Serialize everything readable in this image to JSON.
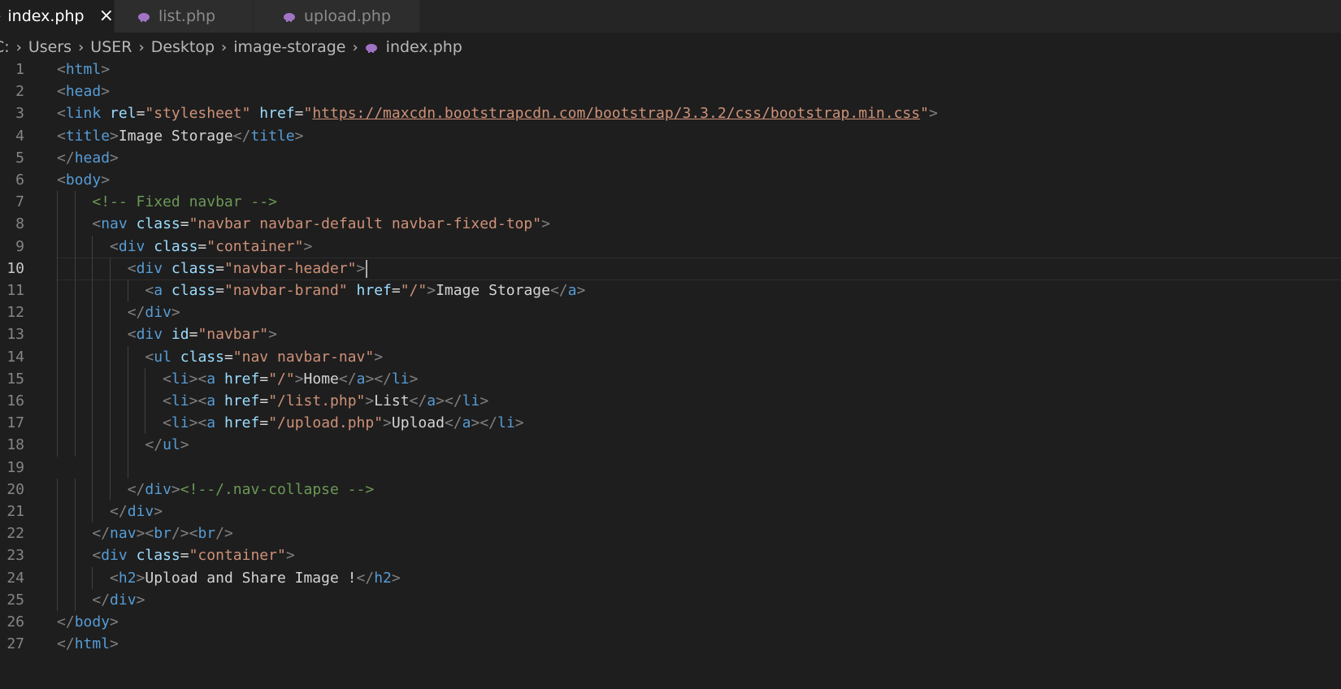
{
  "tabs": [
    {
      "label": "index.php",
      "active": true,
      "icon": "php-elephant-icon"
    },
    {
      "label": "list.php",
      "active": false,
      "icon": "php-elephant-icon"
    },
    {
      "label": "upload.php",
      "active": false,
      "icon": "php-elephant-icon"
    }
  ],
  "breadcrumb": [
    "C:",
    "Users",
    "USER",
    "Desktop",
    "image-storage",
    "index.php"
  ],
  "editor": {
    "current_line": 10,
    "lines": [
      {
        "n": "1",
        "indent": 0,
        "tokens": [
          [
            "p",
            "<"
          ],
          [
            "t",
            "html"
          ],
          [
            "p",
            ">"
          ]
        ]
      },
      {
        "n": "2",
        "indent": 0,
        "tokens": [
          [
            "p",
            "<"
          ],
          [
            "t",
            "head"
          ],
          [
            "p",
            ">"
          ]
        ]
      },
      {
        "n": "3",
        "indent": 0,
        "tokens": [
          [
            "p",
            "<"
          ],
          [
            "t",
            "link"
          ],
          [
            "x",
            " "
          ],
          [
            "a",
            "rel"
          ],
          [
            "x",
            "="
          ],
          [
            "s",
            "\"stylesheet\""
          ],
          [
            "x",
            " "
          ],
          [
            "a",
            "href"
          ],
          [
            "x",
            "="
          ],
          [
            "s",
            "\""
          ],
          [
            "u",
            "https://maxcdn.bootstrapcdn.com/bootstrap/3.3.2/css/bootstrap.min.css"
          ],
          [
            "s",
            "\""
          ],
          [
            "p",
            ">"
          ]
        ]
      },
      {
        "n": "4",
        "indent": 0,
        "tokens": [
          [
            "p",
            "<"
          ],
          [
            "t",
            "title"
          ],
          [
            "p",
            ">"
          ],
          [
            "x",
            "Image Storage"
          ],
          [
            "p",
            "</"
          ],
          [
            "t",
            "title"
          ],
          [
            "p",
            ">"
          ]
        ]
      },
      {
        "n": "5",
        "indent": 0,
        "tokens": [
          [
            "p",
            "</"
          ],
          [
            "t",
            "head"
          ],
          [
            "p",
            ">"
          ]
        ]
      },
      {
        "n": "6",
        "indent": 0,
        "tokens": [
          [
            "p",
            "<"
          ],
          [
            "t",
            "body"
          ],
          [
            "p",
            ">"
          ]
        ]
      },
      {
        "n": "7",
        "indent": 4,
        "tokens": [
          [
            "c",
            "<!-- Fixed navbar -->"
          ]
        ]
      },
      {
        "n": "8",
        "indent": 4,
        "tokens": [
          [
            "p",
            "<"
          ],
          [
            "t",
            "nav"
          ],
          [
            "x",
            " "
          ],
          [
            "a",
            "class"
          ],
          [
            "x",
            "="
          ],
          [
            "s",
            "\"navbar navbar-default navbar-fixed-top\""
          ],
          [
            "p",
            ">"
          ]
        ]
      },
      {
        "n": "9",
        "indent": 6,
        "tokens": [
          [
            "p",
            "<"
          ],
          [
            "t",
            "div"
          ],
          [
            "x",
            " "
          ],
          [
            "a",
            "class"
          ],
          [
            "x",
            "="
          ],
          [
            "s",
            "\"container\""
          ],
          [
            "p",
            ">"
          ]
        ]
      },
      {
        "n": "10",
        "indent": 8,
        "tokens": [
          [
            "p",
            "<"
          ],
          [
            "t",
            "div"
          ],
          [
            "x",
            " "
          ],
          [
            "a",
            "class"
          ],
          [
            "x",
            "="
          ],
          [
            "s",
            "\"navbar-header\""
          ],
          [
            "p",
            ">"
          ]
        ]
      },
      {
        "n": "11",
        "indent": 10,
        "tokens": [
          [
            "p",
            "<"
          ],
          [
            "t",
            "a"
          ],
          [
            "x",
            " "
          ],
          [
            "a",
            "class"
          ],
          [
            "x",
            "="
          ],
          [
            "s",
            "\"navbar-brand\""
          ],
          [
            "x",
            " "
          ],
          [
            "a",
            "href"
          ],
          [
            "x",
            "="
          ],
          [
            "s",
            "\"/\""
          ],
          [
            "p",
            ">"
          ],
          [
            "x",
            "Image Storage"
          ],
          [
            "p",
            "</"
          ],
          [
            "t",
            "a"
          ],
          [
            "p",
            ">"
          ]
        ]
      },
      {
        "n": "12",
        "indent": 8,
        "tokens": [
          [
            "p",
            "</"
          ],
          [
            "t",
            "div"
          ],
          [
            "p",
            ">"
          ]
        ]
      },
      {
        "n": "13",
        "indent": 8,
        "tokens": [
          [
            "p",
            "<"
          ],
          [
            "t",
            "div"
          ],
          [
            "x",
            " "
          ],
          [
            "a",
            "id"
          ],
          [
            "x",
            "="
          ],
          [
            "s",
            "\"navbar\""
          ],
          [
            "p",
            ">"
          ]
        ]
      },
      {
        "n": "14",
        "indent": 10,
        "tokens": [
          [
            "p",
            "<"
          ],
          [
            "t",
            "ul"
          ],
          [
            "x",
            " "
          ],
          [
            "a",
            "class"
          ],
          [
            "x",
            "="
          ],
          [
            "s",
            "\"nav navbar-nav\""
          ],
          [
            "p",
            ">"
          ]
        ]
      },
      {
        "n": "15",
        "indent": 12,
        "tokens": [
          [
            "p",
            "<"
          ],
          [
            "t",
            "li"
          ],
          [
            "p",
            "><"
          ],
          [
            "t",
            "a"
          ],
          [
            "x",
            " "
          ],
          [
            "a",
            "href"
          ],
          [
            "x",
            "="
          ],
          [
            "s",
            "\"/\""
          ],
          [
            "p",
            ">"
          ],
          [
            "x",
            "Home"
          ],
          [
            "p",
            "</"
          ],
          [
            "t",
            "a"
          ],
          [
            "p",
            "></"
          ],
          [
            "t",
            "li"
          ],
          [
            "p",
            ">"
          ]
        ]
      },
      {
        "n": "16",
        "indent": 12,
        "tokens": [
          [
            "p",
            "<"
          ],
          [
            "t",
            "li"
          ],
          [
            "p",
            "><"
          ],
          [
            "t",
            "a"
          ],
          [
            "x",
            " "
          ],
          [
            "a",
            "href"
          ],
          [
            "x",
            "="
          ],
          [
            "s",
            "\"/list.php\""
          ],
          [
            "p",
            ">"
          ],
          [
            "x",
            "List"
          ],
          [
            "p",
            "</"
          ],
          [
            "t",
            "a"
          ],
          [
            "p",
            "></"
          ],
          [
            "t",
            "li"
          ],
          [
            "p",
            ">"
          ]
        ]
      },
      {
        "n": "17",
        "indent": 12,
        "tokens": [
          [
            "p",
            "<"
          ],
          [
            "t",
            "li"
          ],
          [
            "p",
            "><"
          ],
          [
            "t",
            "a"
          ],
          [
            "x",
            " "
          ],
          [
            "a",
            "href"
          ],
          [
            "x",
            "="
          ],
          [
            "s",
            "\"/upload.php\""
          ],
          [
            "p",
            ">"
          ],
          [
            "x",
            "Upload"
          ],
          [
            "p",
            "</"
          ],
          [
            "t",
            "a"
          ],
          [
            "p",
            "></"
          ],
          [
            "t",
            "li"
          ],
          [
            "p",
            ">"
          ]
        ]
      },
      {
        "n": "18",
        "indent": 10,
        "tokens": [
          [
            "p",
            "</"
          ],
          [
            "t",
            "ul"
          ],
          [
            "p",
            ">"
          ]
        ]
      },
      {
        "n": "19",
        "indent": 0,
        "tokens": []
      },
      {
        "n": "20",
        "indent": 8,
        "tokens": [
          [
            "p",
            "</"
          ],
          [
            "t",
            "div"
          ],
          [
            "p",
            ">"
          ],
          [
            "c",
            "<!--/.nav-collapse -->"
          ]
        ]
      },
      {
        "n": "21",
        "indent": 6,
        "tokens": [
          [
            "p",
            "</"
          ],
          [
            "t",
            "div"
          ],
          [
            "p",
            ">"
          ]
        ]
      },
      {
        "n": "22",
        "indent": 4,
        "tokens": [
          [
            "p",
            "</"
          ],
          [
            "t",
            "nav"
          ],
          [
            "p",
            "><"
          ],
          [
            "t",
            "br"
          ],
          [
            "p",
            "/><"
          ],
          [
            "t",
            "br"
          ],
          [
            "p",
            "/>"
          ]
        ]
      },
      {
        "n": "23",
        "indent": 4,
        "tokens": [
          [
            "p",
            "<"
          ],
          [
            "t",
            "div"
          ],
          [
            "x",
            " "
          ],
          [
            "a",
            "class"
          ],
          [
            "x",
            "="
          ],
          [
            "s",
            "\"container\""
          ],
          [
            "p",
            ">"
          ]
        ]
      },
      {
        "n": "24",
        "indent": 6,
        "tokens": [
          [
            "p",
            "<"
          ],
          [
            "t",
            "h2"
          ],
          [
            "p",
            ">"
          ],
          [
            "x",
            "Upload and Share Image !"
          ],
          [
            "p",
            "</"
          ],
          [
            "t",
            "h2"
          ],
          [
            "p",
            ">"
          ]
        ]
      },
      {
        "n": "25",
        "indent": 4,
        "tokens": [
          [
            "p",
            "</"
          ],
          [
            "t",
            "div"
          ],
          [
            "p",
            ">"
          ]
        ]
      },
      {
        "n": "26",
        "indent": 0,
        "tokens": [
          [
            "p",
            "</"
          ],
          [
            "t",
            "body"
          ],
          [
            "p",
            ">"
          ]
        ]
      },
      {
        "n": "27",
        "indent": 0,
        "tokens": [
          [
            "p",
            "</"
          ],
          [
            "t",
            "html"
          ],
          [
            "p",
            ">"
          ]
        ]
      }
    ]
  }
}
